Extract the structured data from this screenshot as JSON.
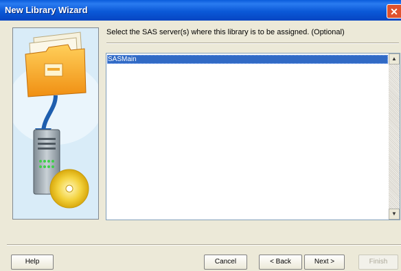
{
  "window": {
    "title": "New Library Wizard"
  },
  "content": {
    "prompt": "Select the SAS server(s) where this library is to be assigned. (Optional)",
    "servers": [
      {
        "label": "SASMain",
        "selected": true
      }
    ]
  },
  "buttons": {
    "help": "Help",
    "cancel": "Cancel",
    "back": "< Back",
    "next": "Next >",
    "finish": "Finish"
  },
  "colors": {
    "titlebar": "#0a5cdb",
    "selection": "#316ac5",
    "dialog_bg": "#ece9d8"
  }
}
